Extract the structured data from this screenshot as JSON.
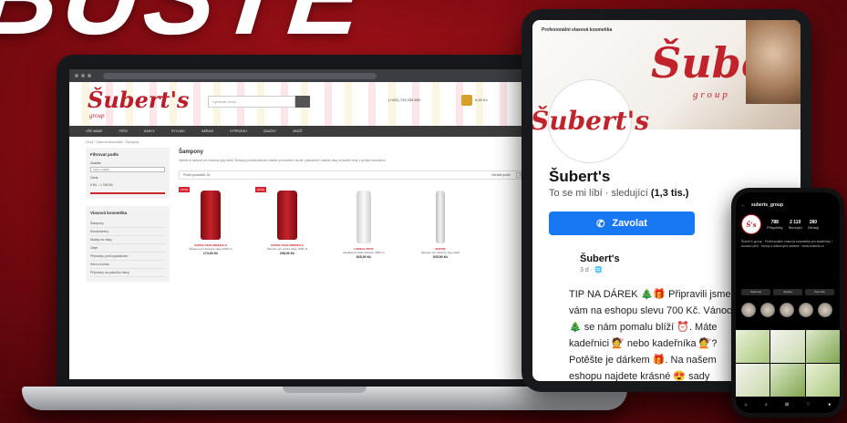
{
  "headline": "BUSTE",
  "colors": {
    "background": "#8a0c13",
    "brand_red": "#c0232c",
    "facebook_blue": "#1877f2"
  },
  "website": {
    "logo": "Šubert's",
    "logo_sub": "group",
    "search_placeholder": "Vyhledat zboží...",
    "phone": "(+420) 733 035 600",
    "cart_label": "0,00 Kč",
    "nav": [
      "VŠE MÁME",
      "PÉČE",
      "BARVY",
      "STYLING",
      "NÁŘADÍ",
      "VÝPRODEJ",
      "ZNAČKY",
      "ZBOŽÍ"
    ],
    "nav_highlight": "DÁRKOVÉ SADY",
    "breadcrumb": "Úvod › Vlasová kosmetika › Šampony",
    "filter_title": "Filtrovat podle",
    "filter_brand_label": "Značka",
    "filter_brand_value": "Vyber značku",
    "filter_price_label": "Cena",
    "filter_price_value": "0 Kč – 1 150 Kč",
    "category_title": "Vlasová kosmetika",
    "categories": [
      "Šampony",
      "Kondicionéry",
      "Masky na vlasy",
      "Oleje",
      "Přípravky proti vypadávání",
      "Séra a tonika",
      "Přípravky na pokožku hlavy"
    ],
    "page_title": "Šampony",
    "intro": "Vyberte si šampon pro všechny typy vlasů. Šampony profesionálních značek pro barvené, suché, poškozené i mastné vlasy za skvělé ceny s rychlým doručením.",
    "sort_label": "Počet produktů: 24",
    "sort_right_label": "Seřadit podle",
    "sort_value": "Oblíbené",
    "products": [
      {
        "tag": "AKCE",
        "brand": "SUPER-STAR MINERALS",
        "name": "Šampon pro barvené vlasy 1000 ml",
        "price": "174,00 Kč"
      },
      {
        "tag": "AKCE",
        "brand": "SUPER-STAR MINERALS",
        "name": "Šampon pro suché vlasy 1000 ml",
        "price": "298,00 Kč"
      },
      {
        "tag": "",
        "brand": "LOREAL PROF",
        "name": "Hloubkově čisticí šampon 1500 ml",
        "price": "825,00 Kč"
      },
      {
        "tag": "",
        "brand": "MATRIX",
        "name": "Šampon pro všechny typy vlasů",
        "price": "525,00 Kč"
      }
    ]
  },
  "facebook": {
    "top_label": "Profesionální vlasová kosmetika",
    "cover_logo": "Šubert's",
    "cover_group": "group",
    "avatar_logo": "Šubert's",
    "name": "Šubert's",
    "likes_prefix": "To se mi líbí · sledující",
    "likes_count": "(1,3 tis.)",
    "call_button": "Zavolat",
    "post_author": "Šubert's",
    "post_meta": "3 d · 🌐",
    "post_text": "TIP NA DÁREK 🎄🎁 Připravili jsme vám na eshopu slevu 700 Kč. Vánoce 🎄 se nám pomalu blíží ⏰. Máte kadeřnici 💇 nebo kadeřníka 💇? Potěšte je dárkem 🎁. Na našem eshopu najdete krásné 😍 sady kadeřnických nů… Zobrazit víc"
  },
  "instagram": {
    "handle": "suberts_group",
    "avatar": "Š's",
    "stats": [
      {
        "value": "788",
        "label": "Příspěvky"
      },
      {
        "value": "2 110",
        "label": "Sledující"
      },
      {
        "value": "280",
        "label": "Sleduji"
      }
    ],
    "bio": "Šubert's group · Profesionální vlasová kosmetika pro kadeřníky i domácí péči · eshop s dárkovými sadami · www.suberts.cz",
    "buttons": [
      "Sledovat",
      "Zpráva",
      "Více info"
    ]
  }
}
